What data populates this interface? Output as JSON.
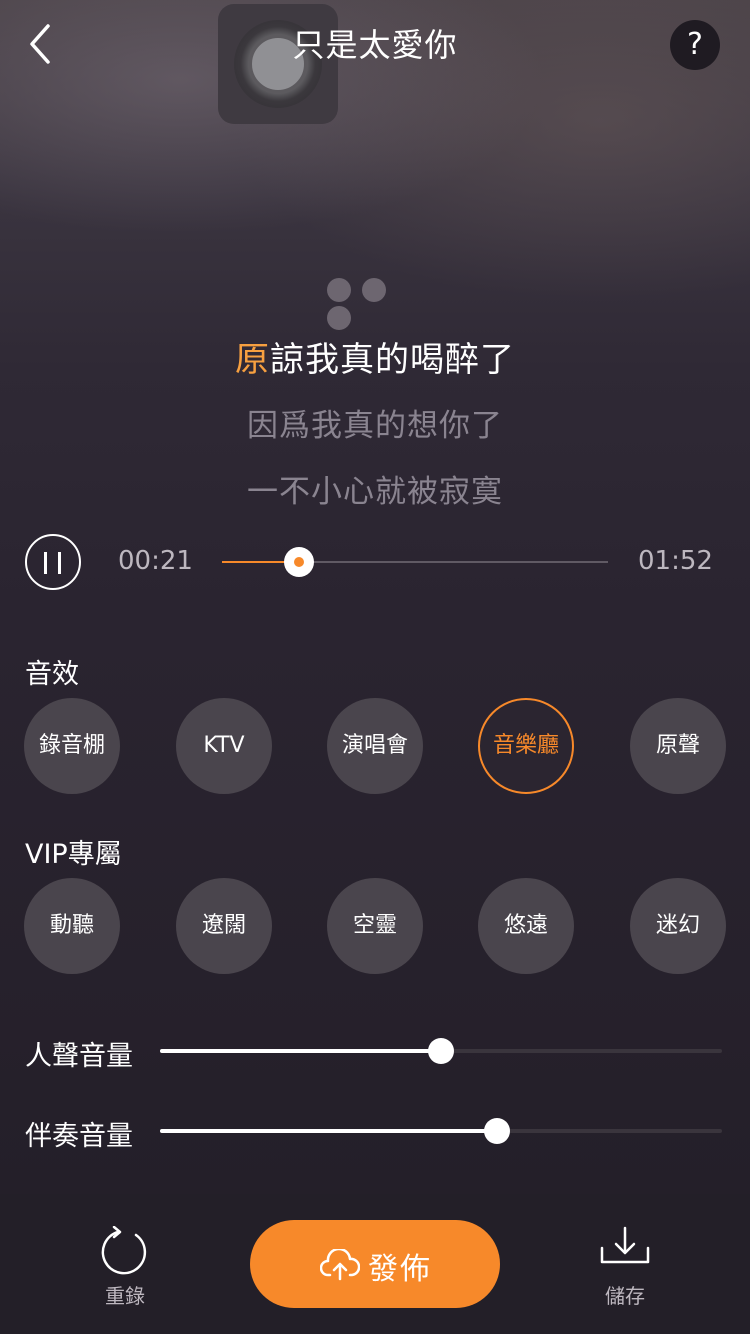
{
  "header": {
    "title": "只是太愛你",
    "help_label": "?"
  },
  "lyrics": {
    "current_highlight": "原",
    "current_rest": "諒我真的喝醉了",
    "next1": "因爲我真的想你了",
    "next2": "一不小心就被寂寞"
  },
  "player": {
    "current_time": "00:21",
    "total_time": "01:52",
    "progress": 0.2,
    "accent_color": "#f7892a"
  },
  "effects": {
    "label": "音效",
    "items": [
      {
        "label": "錄音棚"
      },
      {
        "label": "KTV"
      },
      {
        "label": "演唱會"
      },
      {
        "label": "音樂廳"
      },
      {
        "label": "原聲"
      }
    ],
    "selected": "音樂廳"
  },
  "vip": {
    "label": "VIP專屬",
    "items": [
      {
        "label": "動聽"
      },
      {
        "label": "遼闊"
      },
      {
        "label": "空靈"
      },
      {
        "label": "悠遠"
      },
      {
        "label": "迷幻"
      }
    ]
  },
  "volume": {
    "vocal_label": "人聲音量",
    "vocal_level": 0.5,
    "accompaniment_label": "伴奏音量",
    "accompaniment_level": 0.6
  },
  "footer": {
    "rerecord_label": "重錄",
    "publish_label": "發佈",
    "save_label": "儲存"
  }
}
